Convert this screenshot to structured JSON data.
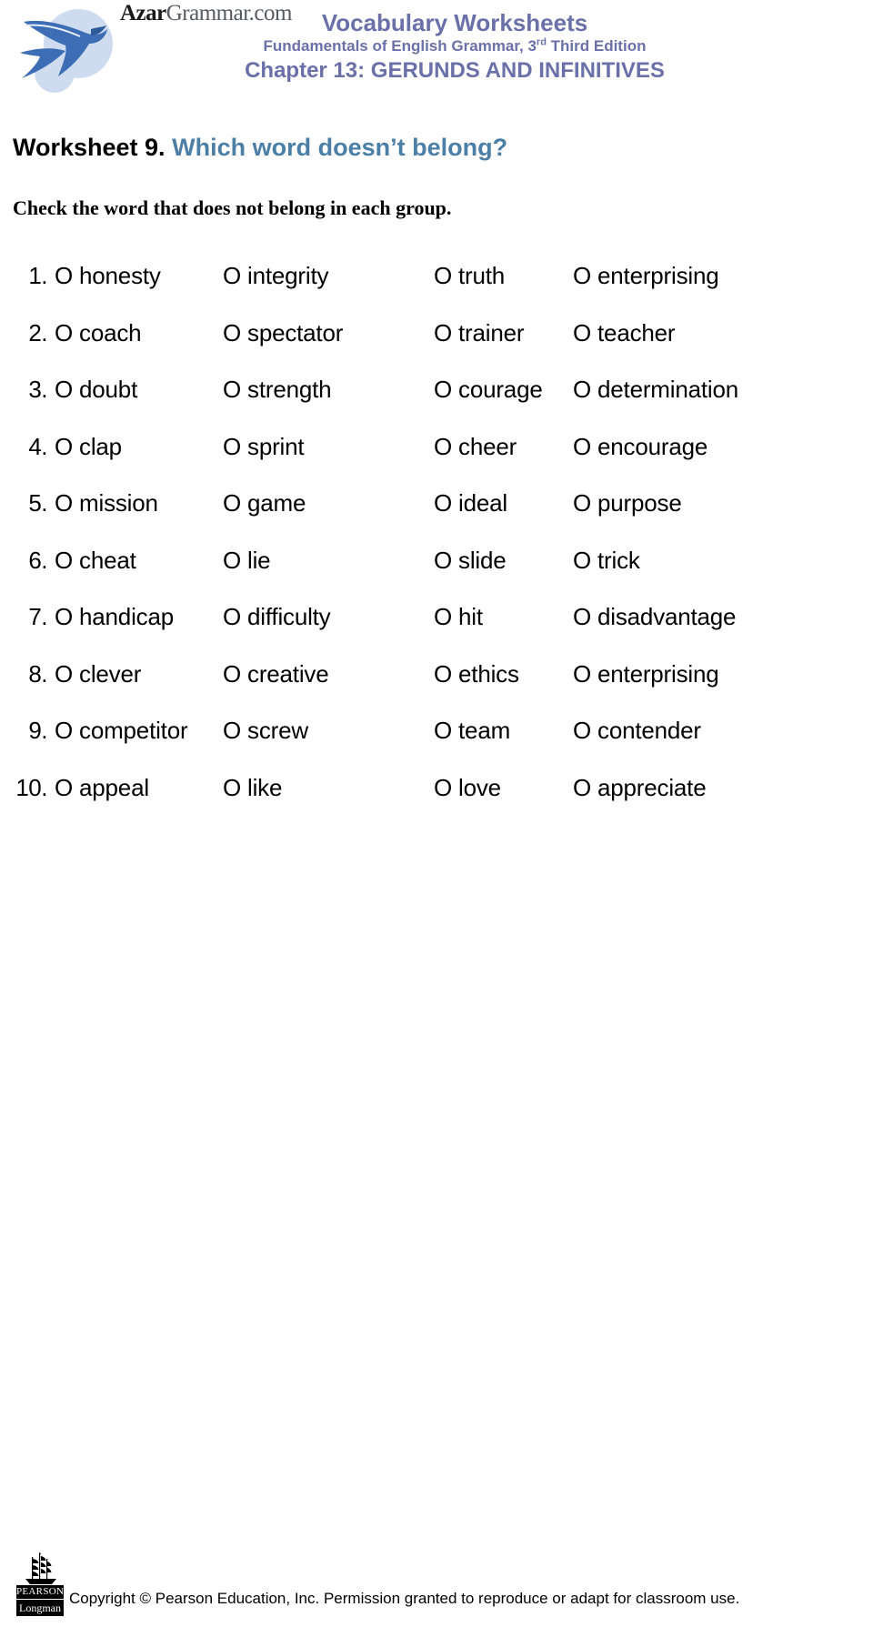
{
  "header": {
    "logo_text_bold": "Azar",
    "logo_text_light": "Grammar.com",
    "bird_icon": "swallow-bird-icon",
    "title": "Vocabulary Worksheets",
    "subtitle_pre": "Fundamentals of English Grammar, 3",
    "subtitle_sup": "rd",
    "subtitle_post": " Third Edition",
    "chapter": "Chapter 13: GERUNDS AND INFINITIVES",
    "title_color": "#6a70a8"
  },
  "worksheet": {
    "label": "Worksheet 9.",
    "question": "Which word doesn’t belong?",
    "label_color": "#000000",
    "question_color": "#4b7fa6",
    "instruction": "Check the word that does not belong in each group."
  },
  "bubble": "O",
  "questions": [
    {
      "number": "1.",
      "options": [
        "honesty",
        "integrity",
        "truth",
        "enterprising"
      ]
    },
    {
      "number": "2.",
      "options": [
        "coach",
        "spectator",
        "trainer",
        "teacher"
      ]
    },
    {
      "number": "3.",
      "options": [
        "doubt",
        "strength",
        "courage",
        "determination"
      ]
    },
    {
      "number": "4.",
      "options": [
        "clap",
        "sprint",
        "cheer",
        "encourage"
      ]
    },
    {
      "number": "5.",
      "options": [
        "mission",
        "game",
        "ideal",
        "purpose"
      ]
    },
    {
      "number": "6.",
      "options": [
        "cheat",
        "lie",
        "slide",
        "trick"
      ]
    },
    {
      "number": "7.",
      "options": [
        "handicap",
        "difficulty",
        "hit",
        "disadvantage"
      ]
    },
    {
      "number": "8.",
      "options": [
        "clever",
        "creative",
        "ethics",
        "enterprising"
      ]
    },
    {
      "number": "9.",
      "options": [
        "competitor",
        "screw",
        "team",
        "contender"
      ]
    },
    {
      "number": "10.",
      "options": [
        "appeal",
        "like",
        "love",
        "appreciate"
      ]
    }
  ],
  "footer": {
    "publisher_top": "PEARSON",
    "publisher_bottom": "Longman",
    "ship_icon": "pearson-ship-icon",
    "copyright": "Copyright © Pearson Education, Inc. Permission granted to reproduce or adapt for classroom use."
  }
}
